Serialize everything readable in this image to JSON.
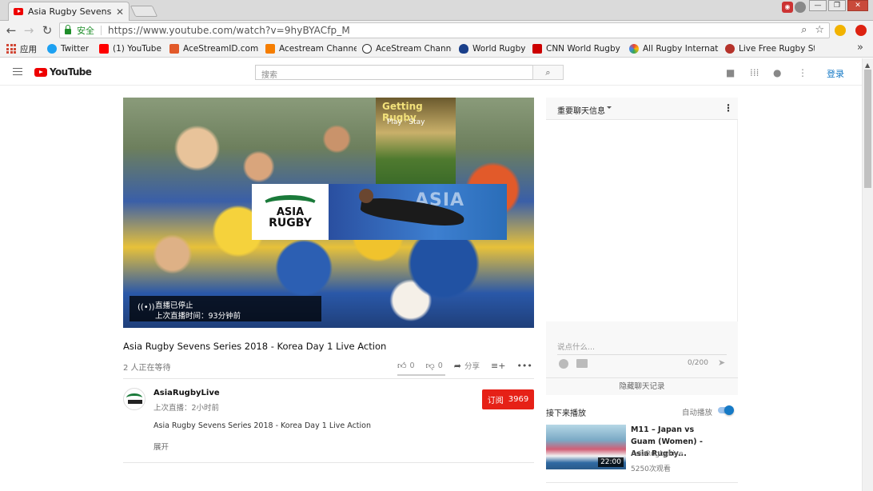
{
  "browser": {
    "tab_title": "Asia Rugby Sevens Seri",
    "secure_label": "安全",
    "url": "https://www.youtube.com/watch?v=9hyBYACfp_M",
    "bookmarks": [
      {
        "label": "应用",
        "icon": "apps-grid-icon",
        "color": "#d14836"
      },
      {
        "label": "Twitter",
        "icon": "twitter-icon",
        "color": "#1da1f2"
      },
      {
        "label": "(1) YouTube",
        "icon": "youtube-icon",
        "color": "#ff0000"
      },
      {
        "label": "AceStreamID.com",
        "icon": "acestream-id-icon",
        "color": "#e25a2a"
      },
      {
        "label": "Acestream Channe",
        "icon": "blogger-icon",
        "color": "#f57d00"
      },
      {
        "label": "AceStream Channe",
        "icon": "soccer-ball-icon",
        "color": "#333333"
      },
      {
        "label": "World Rugby",
        "icon": "world-rugby-icon",
        "color": "#1a3f8a"
      },
      {
        "label": "CNN World Rugby",
        "icon": "cnn-icon",
        "color": "#cc0000"
      },
      {
        "label": "All Rugby Internat",
        "icon": "colorful-flower-icon",
        "color": "#34a853"
      },
      {
        "label": "Live Free Rugby Str",
        "icon": "rugby-player-icon",
        "color": "#b5322a"
      }
    ]
  },
  "youtube": {
    "logo_text": "YouTube",
    "search_placeholder": "搜索",
    "login_label": "登录"
  },
  "video": {
    "sign_title": "Getting Rugby",
    "sign_sub": "Play · Stay",
    "logo_line1": "ASIA",
    "logo_line2": "RUGBY",
    "banner_text": "ASIA",
    "live_status": "直播已停止",
    "live_last": "上次直播时间：93分钟前",
    "title": "Asia Rugby Sevens Series 2018 - Korea Day 1 Live Action",
    "waiting": "2 人正在等待",
    "likes": "0",
    "dislikes": "0",
    "share_label": "分享"
  },
  "channel": {
    "name": "AsiaRugbyLive",
    "last_live": "上次直播：2小时前",
    "description": "Asia Rugby Sevens Series 2018 - Korea Day 1 Live Action",
    "show_more": "展开",
    "subscribe_label": "订阅",
    "subscriber_count": "3969"
  },
  "chat": {
    "title": "重要聊天信息",
    "input_placeholder": "说点什么...",
    "char_count": "0/200",
    "hide_label": "隐藏聊天记录"
  },
  "up_next": {
    "label": "接下来播放",
    "autoplay_label": "自动播放",
    "video": {
      "title": "M11 – Japan vs Guam (Women) - Asia Rugby...",
      "channel": "AsiaRugbyLive",
      "views": "5250次观看",
      "duration": "22:00"
    }
  }
}
